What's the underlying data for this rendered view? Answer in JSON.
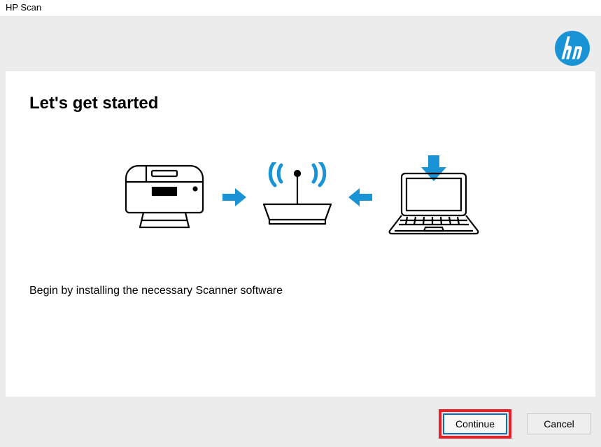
{
  "window": {
    "title": "HP Scan"
  },
  "logo": {
    "label": "hp"
  },
  "main": {
    "heading": "Let's get started",
    "instruction": "Begin by installing the necessary Scanner software"
  },
  "buttons": {
    "continue": "Continue",
    "cancel": "Cancel"
  },
  "colors": {
    "accent": "#1894d6",
    "highlight": "#ee1c25",
    "button_border": "#0a6ebd"
  }
}
